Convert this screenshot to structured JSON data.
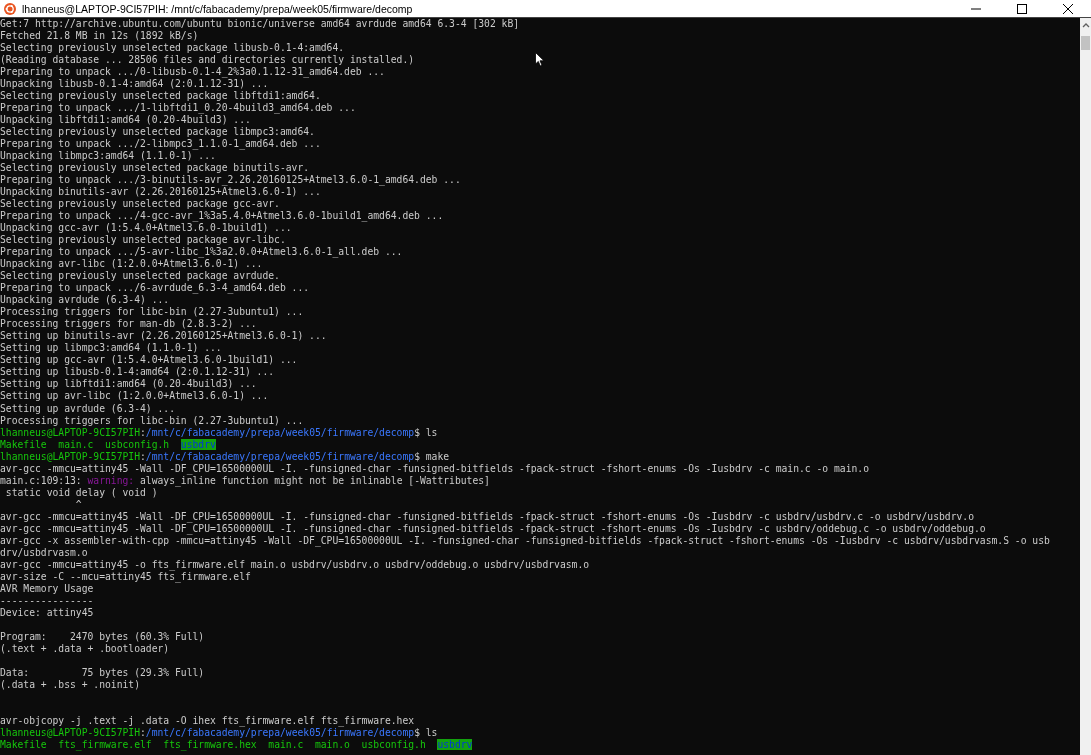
{
  "window": {
    "title": "lhanneus@LAPTOP-9CI57PIH: /mnt/c/fabacademy/prepa/week05/firmware/decomp"
  },
  "lines": [
    {
      "kind": "text",
      "segments": [
        {
          "kind": "plain",
          "text": "Get:7 http://archive.ubuntu.com/ubuntu bionic/universe amd64 avrdude amd64 6.3-4 [302 kB]"
        }
      ]
    },
    {
      "kind": "text",
      "segments": [
        {
          "kind": "plain",
          "text": "Fetched 21.8 MB in 12s (1892 kB/s)"
        }
      ]
    },
    {
      "kind": "text",
      "segments": [
        {
          "kind": "plain",
          "text": "Selecting previously unselected package libusb-0.1-4:amd64."
        }
      ]
    },
    {
      "kind": "text",
      "segments": [
        {
          "kind": "plain",
          "text": "(Reading database ... 28506 files and directories currently installed.)"
        }
      ]
    },
    {
      "kind": "text",
      "segments": [
        {
          "kind": "plain",
          "text": "Preparing to unpack .../0-libusb-0.1-4_2%3a0.1.12-31_amd64.deb ..."
        }
      ]
    },
    {
      "kind": "text",
      "segments": [
        {
          "kind": "plain",
          "text": "Unpacking libusb-0.1-4:amd64 (2:0.1.12-31) ..."
        }
      ]
    },
    {
      "kind": "text",
      "segments": [
        {
          "kind": "plain",
          "text": "Selecting previously unselected package libftdi1:amd64."
        }
      ]
    },
    {
      "kind": "text",
      "segments": [
        {
          "kind": "plain",
          "text": "Preparing to unpack .../1-libftdi1_0.20-4build3_amd64.deb ..."
        }
      ]
    },
    {
      "kind": "text",
      "segments": [
        {
          "kind": "plain",
          "text": "Unpacking libftdi1:amd64 (0.20-4build3) ..."
        }
      ]
    },
    {
      "kind": "text",
      "segments": [
        {
          "kind": "plain",
          "text": "Selecting previously unselected package libmpc3:amd64."
        }
      ]
    },
    {
      "kind": "text",
      "segments": [
        {
          "kind": "plain",
          "text": "Preparing to unpack .../2-libmpc3_1.1.0-1_amd64.deb ..."
        }
      ]
    },
    {
      "kind": "text",
      "segments": [
        {
          "kind": "plain",
          "text": "Unpacking libmpc3:amd64 (1.1.0-1) ..."
        }
      ]
    },
    {
      "kind": "text",
      "segments": [
        {
          "kind": "plain",
          "text": "Selecting previously unselected package binutils-avr."
        }
      ]
    },
    {
      "kind": "text",
      "segments": [
        {
          "kind": "plain",
          "text": "Preparing to unpack .../3-binutils-avr_2.26.20160125+Atmel3.6.0-1_amd64.deb ..."
        }
      ]
    },
    {
      "kind": "text",
      "segments": [
        {
          "kind": "plain",
          "text": "Unpacking binutils-avr (2.26.20160125+Atmel3.6.0-1) ..."
        }
      ]
    },
    {
      "kind": "text",
      "segments": [
        {
          "kind": "plain",
          "text": "Selecting previously unselected package gcc-avr."
        }
      ]
    },
    {
      "kind": "text",
      "segments": [
        {
          "kind": "plain",
          "text": "Preparing to unpack .../4-gcc-avr_1%3a5.4.0+Atmel3.6.0-1build1_amd64.deb ..."
        }
      ]
    },
    {
      "kind": "text",
      "segments": [
        {
          "kind": "plain",
          "text": "Unpacking gcc-avr (1:5.4.0+Atmel3.6.0-1build1) ..."
        }
      ]
    },
    {
      "kind": "text",
      "segments": [
        {
          "kind": "plain",
          "text": "Selecting previously unselected package avr-libc."
        }
      ]
    },
    {
      "kind": "text",
      "segments": [
        {
          "kind": "plain",
          "text": "Preparing to unpack .../5-avr-libc_1%3a2.0.0+Atmel3.6.0-1_all.deb ..."
        }
      ]
    },
    {
      "kind": "text",
      "segments": [
        {
          "kind": "plain",
          "text": "Unpacking avr-libc (1:2.0.0+Atmel3.6.0-1) ..."
        }
      ]
    },
    {
      "kind": "text",
      "segments": [
        {
          "kind": "plain",
          "text": "Selecting previously unselected package avrdude."
        }
      ]
    },
    {
      "kind": "text",
      "segments": [
        {
          "kind": "plain",
          "text": "Preparing to unpack .../6-avrdude_6.3-4_amd64.deb ..."
        }
      ]
    },
    {
      "kind": "text",
      "segments": [
        {
          "kind": "plain",
          "text": "Unpacking avrdude (6.3-4) ..."
        }
      ]
    },
    {
      "kind": "text",
      "segments": [
        {
          "kind": "plain",
          "text": "Processing triggers for libc-bin (2.27-3ubuntu1) ..."
        }
      ]
    },
    {
      "kind": "text",
      "segments": [
        {
          "kind": "plain",
          "text": "Processing triggers for man-db (2.8.3-2) ..."
        }
      ]
    },
    {
      "kind": "text",
      "segments": [
        {
          "kind": "plain",
          "text": "Setting up binutils-avr (2.26.20160125+Atmel3.6.0-1) ..."
        }
      ]
    },
    {
      "kind": "text",
      "segments": [
        {
          "kind": "plain",
          "text": "Setting up libmpc3:amd64 (1.1.0-1) ..."
        }
      ]
    },
    {
      "kind": "text",
      "segments": [
        {
          "kind": "plain",
          "text": "Setting up gcc-avr (1:5.4.0+Atmel3.6.0-1build1) ..."
        }
      ]
    },
    {
      "kind": "text",
      "segments": [
        {
          "kind": "plain",
          "text": "Setting up libusb-0.1-4:amd64 (2:0.1.12-31) ..."
        }
      ]
    },
    {
      "kind": "text",
      "segments": [
        {
          "kind": "plain",
          "text": "Setting up libftdi1:amd64 (0.20-4build3) ..."
        }
      ]
    },
    {
      "kind": "text",
      "segments": [
        {
          "kind": "plain",
          "text": "Setting up avr-libc (1:2.0.0+Atmel3.6.0-1) ..."
        }
      ]
    },
    {
      "kind": "text",
      "segments": [
        {
          "kind": "plain",
          "text": "Setting up avrdude (6.3-4) ..."
        }
      ]
    },
    {
      "kind": "text",
      "segments": [
        {
          "kind": "plain",
          "text": "Processing triggers for libc-bin (2.27-3ubuntu1) ..."
        }
      ]
    },
    {
      "kind": "text",
      "segments": [
        {
          "kind": "user",
          "text": "lhanneus@LAPTOP-9CI57PIH"
        },
        {
          "kind": "plain",
          "text": ":"
        },
        {
          "kind": "path",
          "text": "/mnt/c/fabacademy/prepa/week05/firmware/decomp"
        },
        {
          "kind": "plain",
          "text": "$ ls"
        }
      ]
    },
    {
      "kind": "listing",
      "segments": [
        {
          "kind": "file",
          "text": "Makefile"
        },
        {
          "kind": "file",
          "text": "main.c"
        },
        {
          "kind": "file",
          "text": "usbconfig.h"
        },
        {
          "kind": "dir",
          "text": "usbdrv"
        }
      ]
    },
    {
      "kind": "text",
      "segments": [
        {
          "kind": "user",
          "text": "lhanneus@LAPTOP-9CI57PIH"
        },
        {
          "kind": "plain",
          "text": ":"
        },
        {
          "kind": "path",
          "text": "/mnt/c/fabacademy/prepa/week05/firmware/decomp"
        },
        {
          "kind": "plain",
          "text": "$ make"
        }
      ]
    },
    {
      "kind": "text",
      "segments": [
        {
          "kind": "plain",
          "text": "avr-gcc -mmcu=attiny45 -Wall -DF_CPU=16500000UL -I. -funsigned-char -funsigned-bitfields -fpack-struct -fshort-enums -Os -Iusbdrv -c main.c -o main.o"
        }
      ]
    },
    {
      "kind": "text",
      "segments": [
        {
          "kind": "plain",
          "text": "main.c:109:13: "
        },
        {
          "kind": "warning",
          "text": "warning:"
        },
        {
          "kind": "plain",
          "text": " always_inline function might not be inlinable [-Wattributes]"
        }
      ]
    },
    {
      "kind": "text",
      "segments": [
        {
          "kind": "plain",
          "text": " static void delay ( void )"
        }
      ]
    },
    {
      "kind": "text",
      "segments": [
        {
          "kind": "plain",
          "text": "             ^"
        }
      ]
    },
    {
      "kind": "text",
      "segments": [
        {
          "kind": "plain",
          "text": "avr-gcc -mmcu=attiny45 -Wall -DF_CPU=16500000UL -I. -funsigned-char -funsigned-bitfields -fpack-struct -fshort-enums -Os -Iusbdrv -c usbdrv/usbdrv.c -o usbdrv/usbdrv.o"
        }
      ]
    },
    {
      "kind": "text",
      "segments": [
        {
          "kind": "plain",
          "text": "avr-gcc -mmcu=attiny45 -Wall -DF_CPU=16500000UL -I. -funsigned-char -funsigned-bitfields -fpack-struct -fshort-enums -Os -Iusbdrv -c usbdrv/oddebug.c -o usbdrv/oddebug.o"
        }
      ]
    },
    {
      "kind": "text",
      "segments": [
        {
          "kind": "plain",
          "text": "avr-gcc -x assembler-with-cpp -mmcu=attiny45 -Wall -DF_CPU=16500000UL -I. -funsigned-char -funsigned-bitfields -fpack-struct -fshort-enums -Os -Iusbdrv -c usbdrv/usbdrvasm.S -o usb"
        }
      ]
    },
    {
      "kind": "text",
      "segments": [
        {
          "kind": "plain",
          "text": "drv/usbdrvasm.o"
        }
      ]
    },
    {
      "kind": "text",
      "segments": [
        {
          "kind": "plain",
          "text": "avr-gcc -mmcu=attiny45 -o fts_firmware.elf main.o usbdrv/usbdrv.o usbdrv/oddebug.o usbdrv/usbdrvasm.o"
        }
      ]
    },
    {
      "kind": "text",
      "segments": [
        {
          "kind": "plain",
          "text": "avr-size -C --mcu=attiny45 fts_firmware.elf"
        }
      ]
    },
    {
      "kind": "text",
      "segments": [
        {
          "kind": "plain",
          "text": "AVR Memory Usage"
        }
      ]
    },
    {
      "kind": "text",
      "segments": [
        {
          "kind": "plain",
          "text": "----------------"
        }
      ]
    },
    {
      "kind": "text",
      "segments": [
        {
          "kind": "plain",
          "text": "Device: attiny45"
        }
      ]
    },
    {
      "kind": "blank"
    },
    {
      "kind": "text",
      "segments": [
        {
          "kind": "plain",
          "text": "Program:    2470 bytes (60.3% Full)"
        }
      ]
    },
    {
      "kind": "text",
      "segments": [
        {
          "kind": "plain",
          "text": "(.text + .data + .bootloader)"
        }
      ]
    },
    {
      "kind": "blank"
    },
    {
      "kind": "text",
      "segments": [
        {
          "kind": "plain",
          "text": "Data:         75 bytes (29.3% Full)"
        }
      ]
    },
    {
      "kind": "text",
      "segments": [
        {
          "kind": "plain",
          "text": "(.data + .bss + .noinit)"
        }
      ]
    },
    {
      "kind": "blank"
    },
    {
      "kind": "blank"
    },
    {
      "kind": "text",
      "segments": [
        {
          "kind": "plain",
          "text": "avr-objcopy -j .text -j .data -O ihex fts_firmware.elf fts_firmware.hex"
        }
      ]
    },
    {
      "kind": "text",
      "segments": [
        {
          "kind": "user",
          "text": "lhanneus@LAPTOP-9CI57PIH"
        },
        {
          "kind": "plain",
          "text": ":"
        },
        {
          "kind": "path",
          "text": "/mnt/c/fabacademy/prepa/week05/firmware/decomp"
        },
        {
          "kind": "plain",
          "text": "$ ls"
        }
      ]
    },
    {
      "kind": "listing",
      "segments": [
        {
          "kind": "file",
          "text": "Makefile"
        },
        {
          "kind": "file",
          "text": "fts_firmware.elf"
        },
        {
          "kind": "file",
          "text": "fts_firmware.hex"
        },
        {
          "kind": "file",
          "text": "main.c"
        },
        {
          "kind": "file",
          "text": "main.o"
        },
        {
          "kind": "file",
          "text": "usbconfig.h"
        },
        {
          "kind": "dir",
          "text": "usbdrv"
        }
      ]
    }
  ]
}
